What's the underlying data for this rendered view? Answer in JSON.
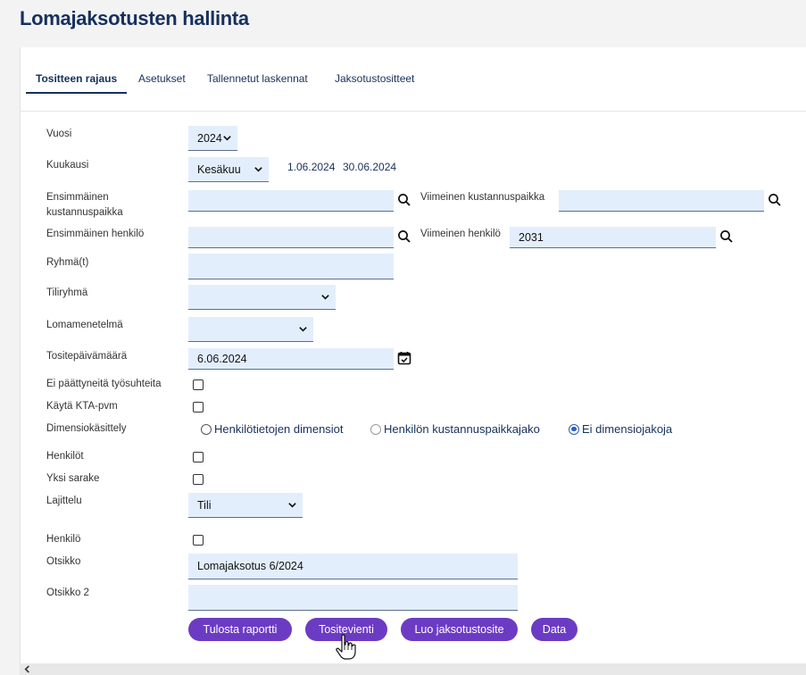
{
  "title": "Lomajaksotusten hallinta",
  "tabs": [
    {
      "label": "Tositteen rajaus",
      "active": true
    },
    {
      "label": "Asetukset",
      "active": false
    },
    {
      "label": "Tallennetut laskennat",
      "active": false
    },
    {
      "label": "Jaksotustositteet",
      "active": false
    }
  ],
  "form": {
    "vuosi": {
      "label": "Vuosi",
      "value": "2024"
    },
    "kuukausi": {
      "label": "Kuukausi",
      "value": "Kesäkuu",
      "start": "1.06.2024",
      "end": "30.06.2024"
    },
    "first_cc": {
      "label_1": "Ensimmäinen",
      "label_2": "kustannuspaikka",
      "value": ""
    },
    "last_cc": {
      "label": "Viimeinen kustannuspaikka",
      "value": ""
    },
    "first_person": {
      "label": "Ensimmäinen henkilö",
      "value": ""
    },
    "last_person": {
      "label": "Viimeinen henkilö",
      "value": "2031"
    },
    "groups": {
      "label": "Ryhmä(t)",
      "value": ""
    },
    "account_group": {
      "label": "Tiliryhmä",
      "value": ""
    },
    "holiday_method": {
      "label": "Lomamenetelmä",
      "value": ""
    },
    "voucher_date": {
      "label": "Tositepäivämäärä",
      "value": "6.06.2024"
    },
    "no_ended": {
      "label": "Ei päättyneitä työsuhteita",
      "checked": false
    },
    "use_kta": {
      "label": "Käytä KTA-pvm",
      "checked": false
    },
    "dimension": {
      "label": "Dimensiokäsittely",
      "options": [
        {
          "label": "Henkilötietojen dimensiot",
          "selected": false
        },
        {
          "label": "Henkilön kustannuspaikkajako",
          "selected": false
        },
        {
          "label": "Ei dimensiojakoja",
          "selected": true
        }
      ]
    },
    "persons": {
      "label": "Henkilöt",
      "checked": false
    },
    "one_column": {
      "label": "Yksi sarake",
      "checked": false
    },
    "sorting": {
      "label": "Lajittelu",
      "value": "Tili"
    },
    "person": {
      "label": "Henkilö",
      "checked": false
    },
    "heading": {
      "label": "Otsikko",
      "value": "Lomajaksotus 6/2024"
    },
    "heading2": {
      "label": "Otsikko 2",
      "value": ""
    }
  },
  "buttons": {
    "print": "Tulosta raportti",
    "voucher": "Tositevienti",
    "create": "Luo jaksotustosite",
    "data": "Data"
  },
  "colors": {
    "accent": "#6c3bc4",
    "title": "#17305c",
    "field": "#e3eefc"
  }
}
